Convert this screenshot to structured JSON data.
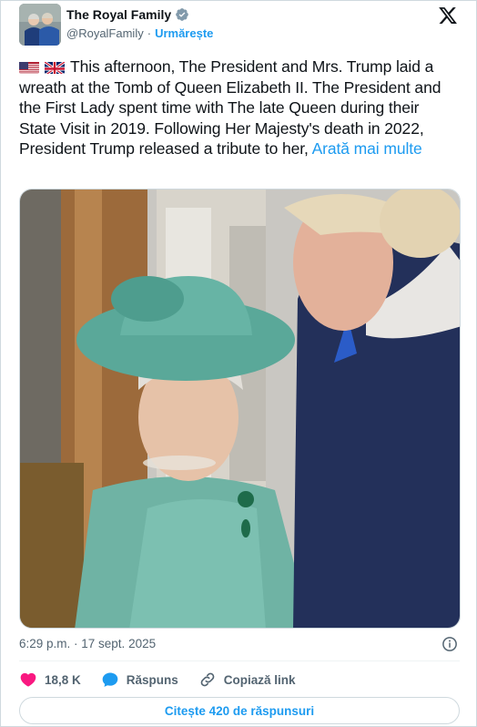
{
  "account": {
    "display_name": "The Royal Family",
    "handle": "@RoyalFamily",
    "separator": "·",
    "follow_label": "Urmărește",
    "verified_color": "#829aab",
    "accent_color": "#1d9bf0"
  },
  "tweet": {
    "text": "This afternoon, The President and Mrs. Trump laid a wreath at the Tomb of Queen Elizabeth II. The President and the First Lady spent time with The late Queen during their State Visit in 2019. Following Her Majesty's death in 2022, President Trump released a tribute to her,",
    "show_more": "Arată mai multe",
    "flags": [
      "us-flag-icon",
      "uk-flag-icon"
    ]
  },
  "meta": {
    "timestamp": "6:29 p.m. · 17 sept. 2025"
  },
  "actions": {
    "like_count": "18,8 K",
    "reply_label": "Răspuns",
    "copy_label": "Copiază link",
    "like_color": "#f91880"
  },
  "footer": {
    "read_replies_label": "Citește 420 de răspunsuri"
  }
}
